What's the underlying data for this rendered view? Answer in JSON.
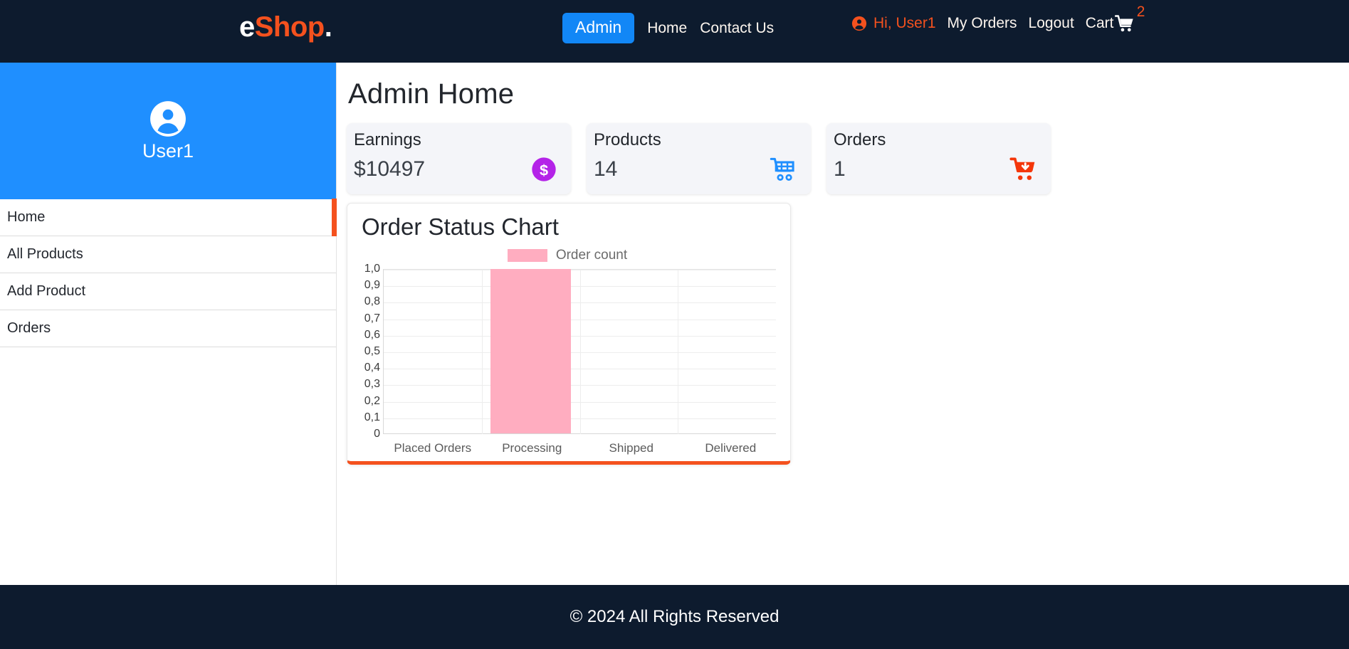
{
  "topnav": {
    "brand": {
      "part1": "e",
      "part2": "Shop",
      "part3": "."
    },
    "admin_button": "Admin",
    "links": [
      {
        "label": "Home"
      },
      {
        "label": "Contact Us"
      }
    ],
    "greeting": "Hi, User1",
    "user_icon": "user-circle-icon",
    "right_links": [
      {
        "label": "My Orders"
      },
      {
        "label": "Logout"
      }
    ],
    "cart_label": "Cart",
    "cart_icon": "shopping-cart-icon",
    "cart_count": "2"
  },
  "sidebar": {
    "avatar_icon": "user-avatar-icon",
    "username": "User1",
    "items": [
      {
        "label": "Home",
        "active": true
      },
      {
        "label": "All Products",
        "active": false
      },
      {
        "label": "Add Product",
        "active": false
      },
      {
        "label": "Orders",
        "active": false
      }
    ]
  },
  "main": {
    "page_title": "Admin Home",
    "stats": [
      {
        "title": "Earnings",
        "value": "$10497",
        "icon": "dollar-circle-icon",
        "icon_color": "#b423e8"
      },
      {
        "title": "Products",
        "value": "14",
        "icon": "shopping-cart-outline-icon",
        "icon_color": "#1f8fff"
      },
      {
        "title": "Orders",
        "value": "1",
        "icon": "cart-download-icon",
        "icon_color": "#f4360a"
      }
    ]
  },
  "chart_data": {
    "type": "bar",
    "title": "Order Status Chart",
    "categories": [
      "Placed Orders",
      "Processing",
      "Shipped",
      "Delivered"
    ],
    "values": [
      0,
      1,
      0,
      0
    ],
    "series": [
      {
        "name": "Order count",
        "values": [
          0,
          1,
          0,
          0
        ],
        "color": "#ffadc0"
      }
    ],
    "legend": [
      {
        "label": "Order count",
        "color": "#ffadc0"
      }
    ],
    "legend_position": "top",
    "xlabel": "",
    "ylabel": "",
    "ylim": [
      0,
      1
    ],
    "ytick_labels": [
      "1,0",
      "0,9",
      "0,8",
      "0,7",
      "0,6",
      "0,5",
      "0,4",
      "0,3",
      "0,2",
      "0,1",
      "0"
    ],
    "ytick_values": [
      1.0,
      0.9,
      0.8,
      0.7,
      0.6,
      0.5,
      0.4,
      0.3,
      0.2,
      0.1,
      0
    ],
    "grid": true
  },
  "footer": {
    "text": "© 2024 All Rights Reserved"
  },
  "colors": {
    "nav_bg": "#0d1b2e",
    "accent_orange": "#f4511e",
    "accent_blue": "#1f8fff",
    "card_bg": "#f4f5f9",
    "bar_pink": "#ffadc0"
  }
}
